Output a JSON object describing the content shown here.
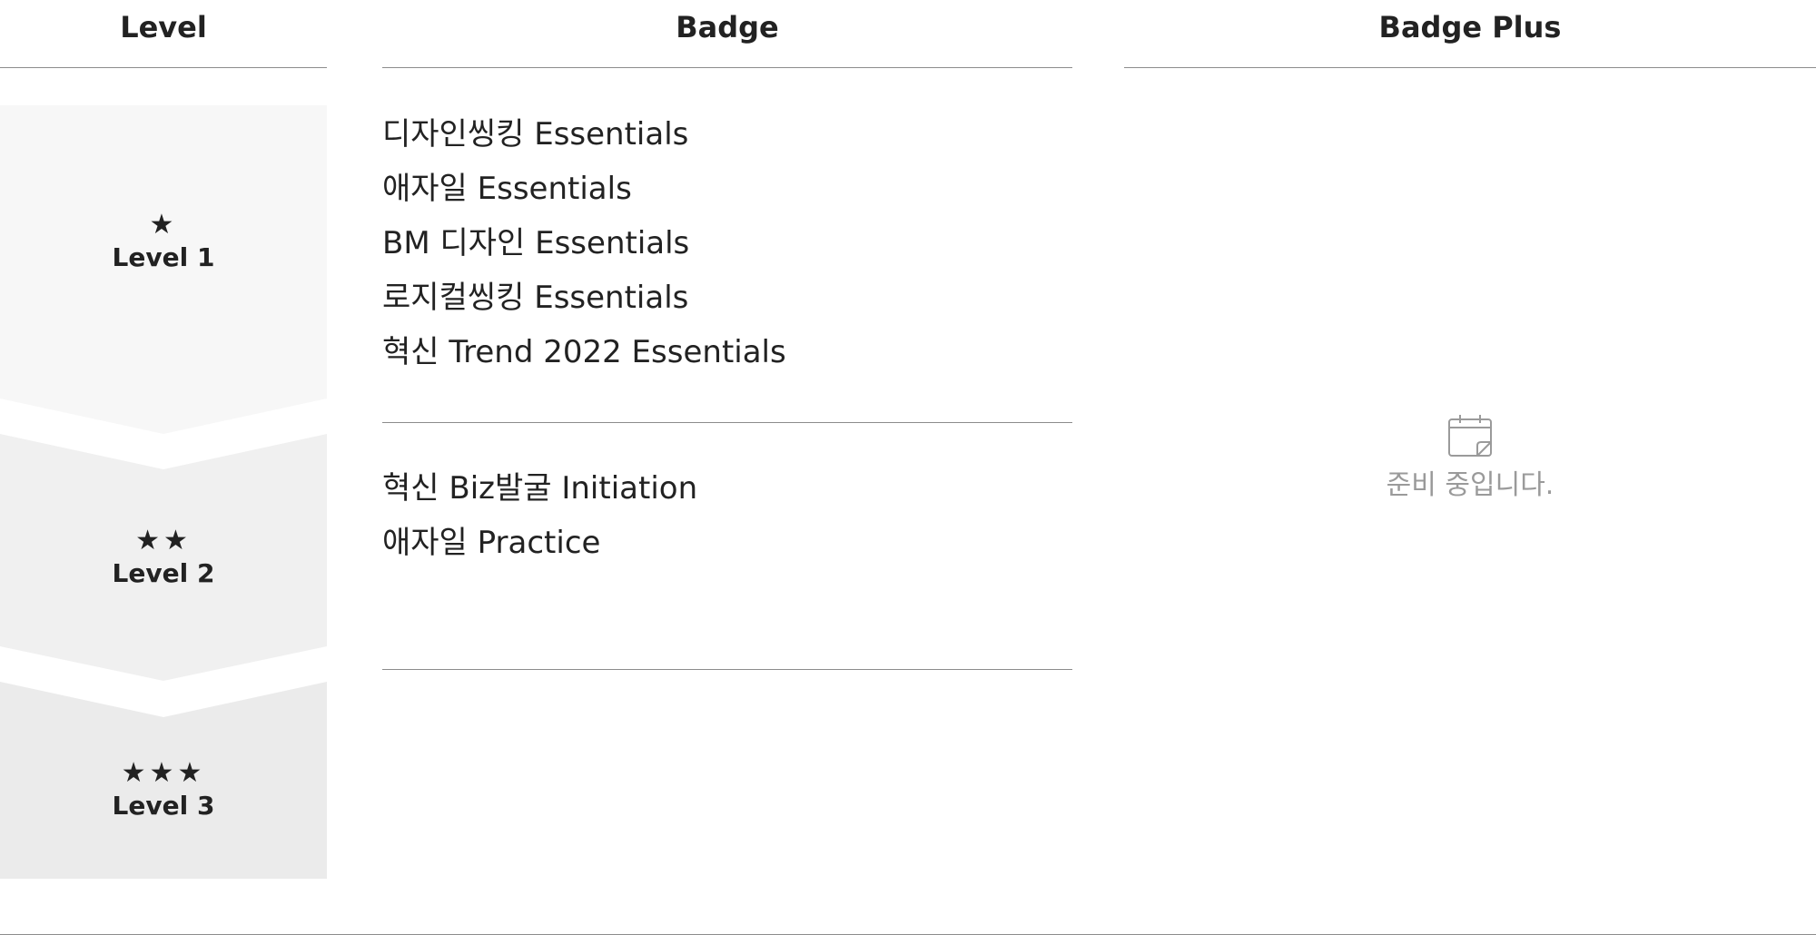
{
  "headers": {
    "level": "Level",
    "badge": "Badge",
    "badge_plus": "Badge Plus"
  },
  "levels": [
    {
      "stars": "★",
      "label": "Level 1",
      "fill": "#f7f7f7"
    },
    {
      "stars": "★★",
      "label": "Level 2",
      "fill": "#f0f0f0"
    },
    {
      "stars": "★★★",
      "label": "Level 3",
      "fill": "#ebebeb"
    }
  ],
  "badges": {
    "level1": [
      "디자인씽킹 Essentials",
      "애자일 Essentials",
      "BM 디자인 Essentials",
      "로지컬씽킹 Essentials",
      "혁신 Trend 2022 Essentials"
    ],
    "level2": [
      "혁신 Biz발굴 Initiation",
      "애자일 Practice"
    ]
  },
  "badge_plus": {
    "icon": "calendar-icon",
    "message": "준비 중입니다."
  },
  "colors": {
    "text": "#222222",
    "muted": "#9a9a9a",
    "divider": "#8c8c8c"
  }
}
